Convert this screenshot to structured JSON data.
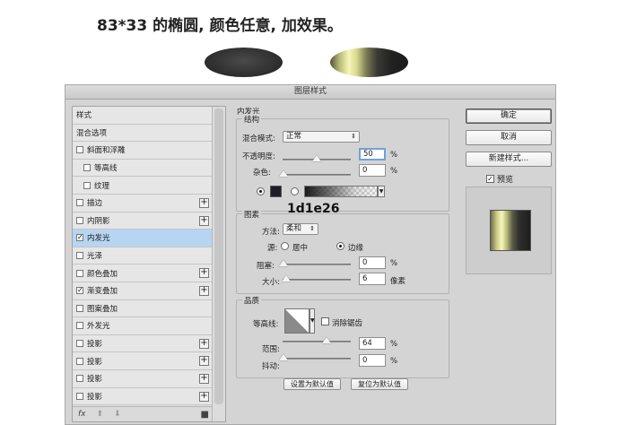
{
  "caption": "83*33 的椭圆, 颜色任意, 加效果。",
  "colors": {
    "ellipse_fill": "#2c2c2c",
    "glow_color": "#1d1e26",
    "selected_row": "#b7d5f2",
    "dialog_bg": "#d4d4d4"
  },
  "dialog": {
    "title": "图层样式",
    "style_list": {
      "items": [
        {
          "label": "样式",
          "checkbox": false,
          "checked": false,
          "plus": false,
          "selected": false
        },
        {
          "label": "混合选项",
          "checkbox": false,
          "checked": false,
          "plus": false,
          "selected": false
        },
        {
          "label": "斜面和浮雕",
          "checkbox": true,
          "checked": false,
          "plus": false,
          "selected": false
        },
        {
          "label": "等高线",
          "checkbox": true,
          "checked": false,
          "plus": false,
          "selected": false,
          "indent": true
        },
        {
          "label": "纹理",
          "checkbox": true,
          "checked": false,
          "plus": false,
          "selected": false,
          "indent": true
        },
        {
          "label": "描边",
          "checkbox": true,
          "checked": false,
          "plus": true,
          "selected": false
        },
        {
          "label": "内阴影",
          "checkbox": true,
          "checked": false,
          "plus": true,
          "selected": false
        },
        {
          "label": "内发光",
          "checkbox": true,
          "checked": true,
          "plus": false,
          "selected": true
        },
        {
          "label": "光泽",
          "checkbox": true,
          "checked": false,
          "plus": false,
          "selected": false
        },
        {
          "label": "颜色叠加",
          "checkbox": true,
          "checked": false,
          "plus": true,
          "selected": false
        },
        {
          "label": "渐变叠加",
          "checkbox": true,
          "checked": true,
          "plus": true,
          "selected": false
        },
        {
          "label": "图案叠加",
          "checkbox": true,
          "checked": false,
          "plus": false,
          "selected": false
        },
        {
          "label": "外发光",
          "checkbox": true,
          "checked": false,
          "plus": false,
          "selected": false
        },
        {
          "label": "投影",
          "checkbox": true,
          "checked": false,
          "plus": true,
          "selected": false
        },
        {
          "label": "投影",
          "checkbox": true,
          "checked": false,
          "plus": true,
          "selected": false
        },
        {
          "label": "投影",
          "checkbox": true,
          "checked": false,
          "plus": true,
          "selected": false
        },
        {
          "label": "投影",
          "checkbox": true,
          "checked": false,
          "plus": true,
          "selected": false
        }
      ],
      "footer": {
        "fx": "fx",
        "up": "⬆",
        "down": "⬇",
        "trash": "🗑"
      }
    },
    "inner_glow": {
      "title": "内发光",
      "structure": {
        "label": "结构",
        "blend_mode_label": "混合模式:",
        "blend_mode_value": "正常",
        "opacity_label": "不透明度:",
        "opacity_value": "50",
        "opacity_unit": "%",
        "noise_label": "杂色:",
        "noise_value": "0",
        "noise_unit": "%",
        "color_hex_overlay": "1d1e26"
      },
      "elements": {
        "label": "图素",
        "technique_label": "方法:",
        "technique_value": "柔和",
        "source_label": "源:",
        "source_center": "居中",
        "source_edge": "边缘",
        "choke_label": "阻塞:",
        "choke_value": "0",
        "choke_unit": "%",
        "size_label": "大小:",
        "size_value": "6",
        "size_unit": "像素"
      },
      "quality": {
        "label": "品质",
        "contour_label": "等高线:",
        "antialias_label": "消除锯齿",
        "range_label": "范围:",
        "range_value": "64",
        "range_unit": "%",
        "jitter_label": "抖动:",
        "jitter_value": "0",
        "jitter_unit": "%"
      },
      "make_default": "设置为默认值",
      "reset_default": "复位为默认值"
    },
    "buttons": {
      "ok": "确定",
      "cancel": "取消",
      "new_style": "新建样式...",
      "preview_label": "预览"
    }
  }
}
